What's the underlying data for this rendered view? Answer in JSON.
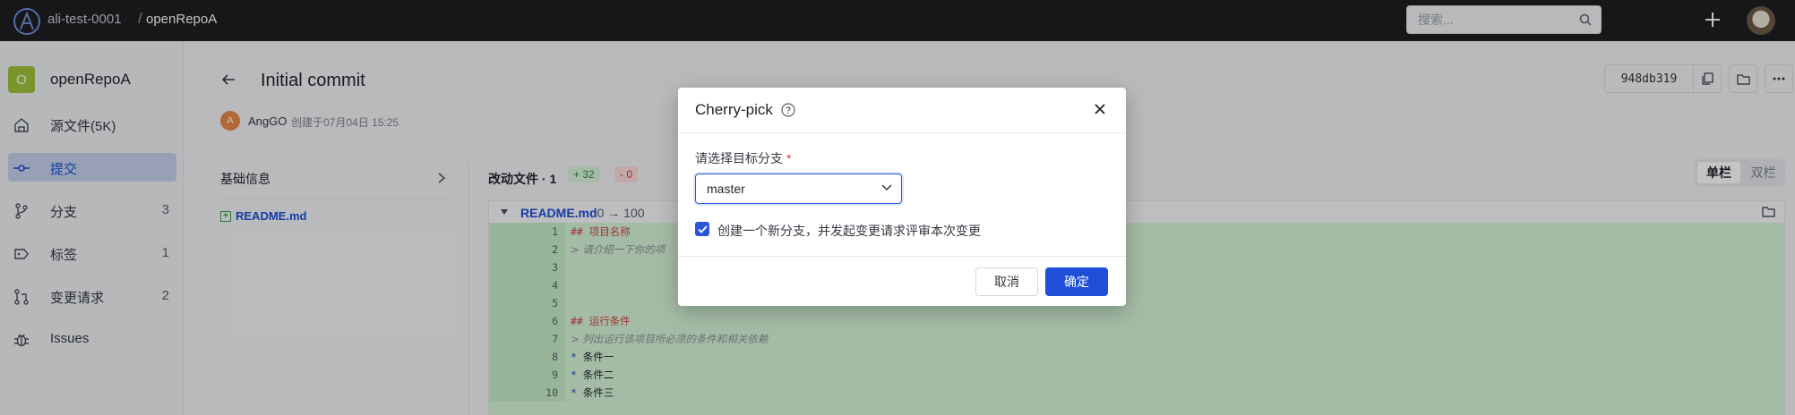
{
  "topbar": {
    "org": "ali-test-0001",
    "separator": "/",
    "repo": "openRepoA",
    "search_placeholder": "搜索..."
  },
  "sidebar": {
    "repo_initial": "O",
    "repo_name": "openRepoA",
    "items": [
      {
        "label": "源文件(5K)",
        "count": ""
      },
      {
        "label": "提交",
        "count": ""
      },
      {
        "label": "分支",
        "count": "3"
      },
      {
        "label": "标签",
        "count": "1"
      },
      {
        "label": "变更请求",
        "count": "2"
      },
      {
        "label": "Issues",
        "count": ""
      }
    ]
  },
  "commit": {
    "title": "Initial commit",
    "author_initial": "A",
    "author": "AngGO",
    "created": "创建于07月04日 15:25",
    "hash": "948db319"
  },
  "details": {
    "base_info": "基础信息",
    "files": [
      {
        "name": "README.md"
      }
    ],
    "changed_files_label": "改动文件 · 1",
    "additions": "+ 32",
    "deletions": "- 0",
    "view_single": "单栏",
    "view_double": "双栏"
  },
  "diff": {
    "file_name": "README.md",
    "stats": "· 0 → 100",
    "lines": [
      {
        "n": "1",
        "text": "## 项目名称",
        "kind": "h"
      },
      {
        "n": "2",
        "text": "> 请介绍一下你的项",
        "kind": "q"
      },
      {
        "n": "3",
        "text": "",
        "kind": "l"
      },
      {
        "n": "4",
        "text": "",
        "kind": "l"
      },
      {
        "n": "5",
        "text": "",
        "kind": "l"
      },
      {
        "n": "6",
        "text": "## 运行条件",
        "kind": "h"
      },
      {
        "n": "7",
        "text": "> 列出运行该项目所必须的条件和相关依赖",
        "kind": "q"
      },
      {
        "n": "8",
        "text": "条件一",
        "kind": "li"
      },
      {
        "n": "9",
        "text": "条件二",
        "kind": "li"
      },
      {
        "n": "10",
        "text": "条件三",
        "kind": "li"
      }
    ]
  },
  "modal": {
    "title": "Cherry-pick",
    "branch_label": "请选择目标分支",
    "required_mark": "*",
    "branch_value": "master",
    "checkbox_label": "创建一个新分支，并发起变更请求评审本次变更",
    "checkbox_checked": true,
    "cancel": "取消",
    "confirm": "确定"
  },
  "colors": {
    "accent": "#1f4fd8",
    "topbar": "#1e1f22",
    "diff_add_bg": "#d6f5d9",
    "repo_badge": "#9fc23d"
  }
}
